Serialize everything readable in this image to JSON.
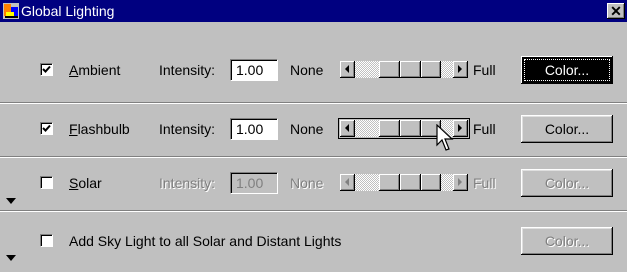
{
  "window": {
    "title": "Global Lighting",
    "close_glyph": "✕",
    "icon": "app-lighting-icon"
  },
  "rows": [
    {
      "checked": true,
      "label_mnemonic": "A",
      "label_rest": "mbient",
      "intensity_label": "Intensity:",
      "intensity_value": "1.00",
      "none_label": "None",
      "full_label": "Full",
      "color_label": "Color...",
      "enabled": true,
      "slider_level": 0.68
    },
    {
      "checked": true,
      "label_mnemonic": "F",
      "label_rest": "lashbulb",
      "intensity_label": "Intensity:",
      "intensity_value": "1.00",
      "none_label": "None",
      "full_label": "Full",
      "color_label": "Color...",
      "enabled": true,
      "slider_level": 0.68
    },
    {
      "checked": false,
      "label_mnemonic": "S",
      "label_rest": "olar",
      "intensity_label": "Intensity:",
      "intensity_value": "1.00",
      "none_label": "None",
      "full_label": "Full",
      "color_label": "Color...",
      "enabled": false,
      "slider_level": 0.68
    }
  ],
  "sky": {
    "checked": false,
    "label": "Add Sky Light to all Solar and Distant Lights",
    "color_label": "Color..."
  },
  "colors": {
    "titlebar": "#000080",
    "face": "#c0c0c0",
    "disabled_text": "#808080"
  }
}
